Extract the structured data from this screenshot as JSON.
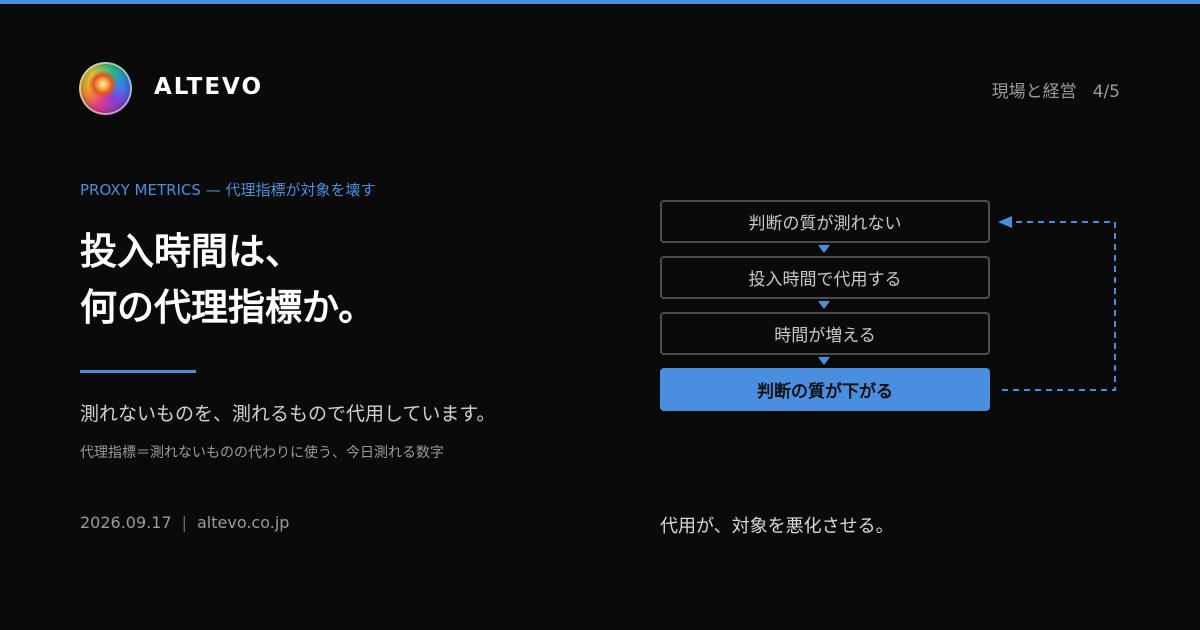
{
  "header": {
    "brand_name": "ALTEVO",
    "section": "現場と経営",
    "page": "4/5"
  },
  "content": {
    "eyebrow": "PROXY METRICS — 代理指標が対象を壊す",
    "headline_line1": "投入時間は、",
    "headline_line2": "何の代理指標か。",
    "subtitle": "測れないものを、測れるもので代用しています。",
    "note": "代理指標＝測れないものの代わりに使う、今日測れる数字"
  },
  "footer": {
    "date": "2026.09.17",
    "separator": "|",
    "site": "altevo.co.jp"
  },
  "diagram": {
    "steps": [
      "判断の質が測れない",
      "投入時間で代用する",
      "時間が増える",
      "判断の質が下がる"
    ],
    "caption": "代用が、対象を悪化させる。"
  },
  "colors": {
    "accent": "#4a8ee0",
    "background": "#0a0a0a",
    "box_border": "#4c4c4c"
  },
  "icons": {
    "logo": "cosmic-orb-logo"
  }
}
